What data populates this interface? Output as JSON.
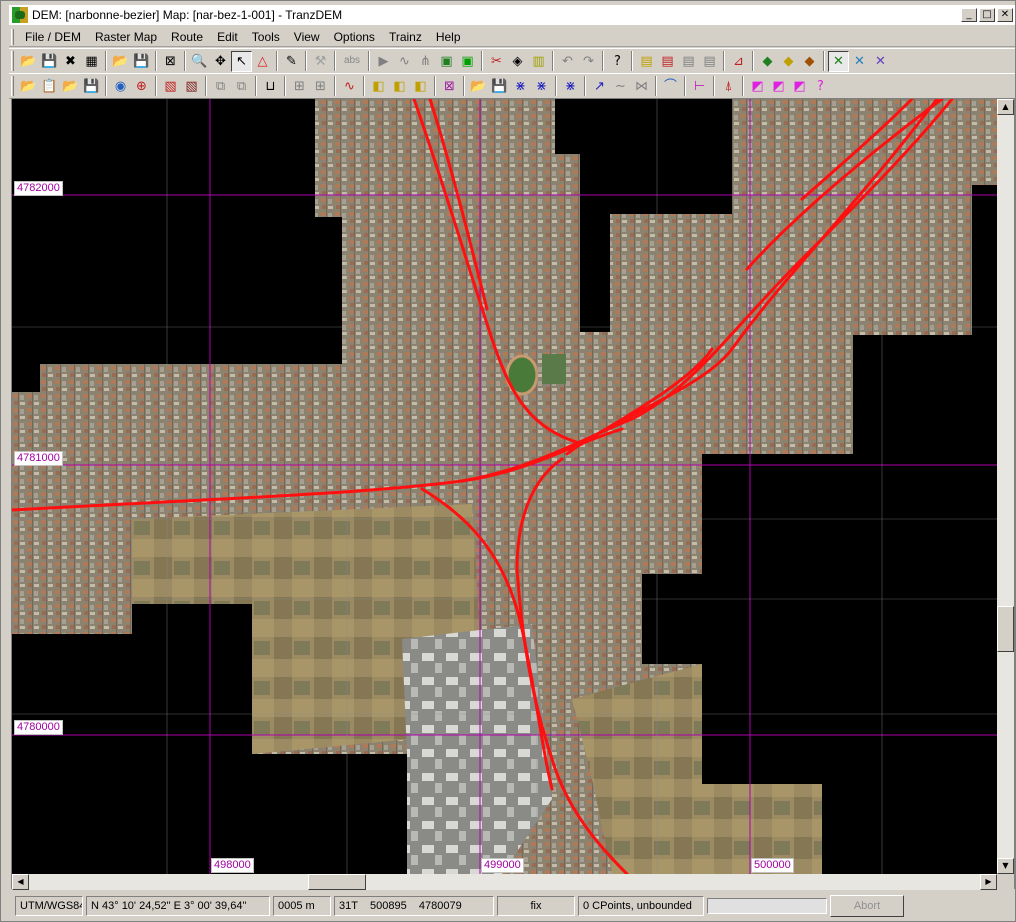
{
  "window": {
    "title": "DEM: [narbonne-bezier] Map: [nar-bez-1-001] - TranzDEM",
    "controls": {
      "minimize": "_",
      "maximize": "□",
      "close": "✕"
    }
  },
  "menu": [
    "File / DEM",
    "Raster Map",
    "Route",
    "Edit",
    "Tools",
    "View",
    "Options",
    "Trainz",
    "Help"
  ],
  "toolbar1": [
    {
      "icon": "open-folder-icon",
      "glyph": "📂"
    },
    {
      "icon": "save-icon",
      "glyph": "💾"
    },
    {
      "icon": "delete-map-icon",
      "glyph": "✖"
    },
    {
      "icon": "map-color-icon",
      "glyph": "▦"
    },
    {
      "sep": true
    },
    {
      "icon": "open-raster-icon",
      "glyph": "📂"
    },
    {
      "icon": "save-raster-icon",
      "glyph": "💾"
    },
    {
      "sep": true
    },
    {
      "icon": "zoom-cross-icon",
      "glyph": "⊠"
    },
    {
      "sep": true
    },
    {
      "icon": "magnifier-icon",
      "glyph": "🔍"
    },
    {
      "icon": "pan-icon",
      "glyph": "✥"
    },
    {
      "icon": "pointer-icon",
      "glyph": "↖",
      "pressed": true
    },
    {
      "icon": "triangle-icon",
      "glyph": "△",
      "color": "#e02020"
    },
    {
      "sep": true
    },
    {
      "icon": "eyedropper-icon",
      "glyph": "✎"
    },
    {
      "sep": true
    },
    {
      "icon": "tools-disabled-icon",
      "glyph": "⚒",
      "color": "#a0a0a0"
    },
    {
      "sep": true
    },
    {
      "icon": "abs-icon",
      "text": "abs"
    },
    {
      "sep": true
    },
    {
      "icon": "play-icon",
      "glyph": "▶",
      "color": "#808080"
    },
    {
      "icon": "curve-icon",
      "glyph": "∿",
      "color": "#808080"
    },
    {
      "icon": "track-split-icon",
      "glyph": "⋔",
      "color": "#808080"
    },
    {
      "icon": "track-select-icon",
      "glyph": "▣",
      "color": "#208020"
    },
    {
      "icon": "track-green-icon",
      "glyph": "▣",
      "color": "#00a000"
    },
    {
      "sep": true
    },
    {
      "icon": "scissors-icon",
      "glyph": "✂",
      "color": "#c02020"
    },
    {
      "icon": "fill-icon",
      "glyph": "◈"
    },
    {
      "icon": "ruler-icon",
      "glyph": "▥",
      "color": "#a0a000"
    },
    {
      "sep": true
    },
    {
      "icon": "undo-icon",
      "glyph": "↶",
      "color": "#808080"
    },
    {
      "icon": "redo-icon",
      "glyph": "↷",
      "color": "#808080"
    },
    {
      "sep": true
    },
    {
      "icon": "help-icon",
      "glyph": "?",
      "color": "#000000"
    },
    {
      "sep": true
    },
    {
      "icon": "layer-icon",
      "glyph": "▤",
      "color": "#c0a000"
    },
    {
      "icon": "layer-red-icon",
      "glyph": "▤",
      "color": "#c02020"
    },
    {
      "icon": "layer-grey-icon",
      "glyph": "▤",
      "color": "#808080"
    },
    {
      "icon": "layer-grey2-icon",
      "glyph": "▤",
      "color": "#808080"
    },
    {
      "sep": true
    },
    {
      "icon": "measure-icon",
      "glyph": "⊿",
      "color": "#c02020"
    },
    {
      "sep": true
    },
    {
      "icon": "texture-icon",
      "glyph": "◆",
      "color": "#208020"
    },
    {
      "icon": "texture2-icon",
      "glyph": "◆",
      "color": "#c0a000"
    },
    {
      "icon": "texture3-icon",
      "glyph": "◆",
      "color": "#a05000"
    },
    {
      "sep": true
    },
    {
      "icon": "cross-green-icon",
      "glyph": "✕",
      "color": "#208020",
      "pressed": true
    },
    {
      "icon": "cross-blue-icon",
      "glyph": "✕",
      "color": "#2080c0"
    },
    {
      "icon": "cross-multi-icon",
      "glyph": "✕",
      "color": "#6040c0"
    }
  ],
  "toolbar2": [
    {
      "icon": "open-icon",
      "glyph": "📂"
    },
    {
      "icon": "paste-icon",
      "glyph": "📋"
    },
    {
      "icon": "open2-icon",
      "glyph": "📂"
    },
    {
      "icon": "save-grey-icon",
      "glyph": "💾",
      "color": "#808080"
    },
    {
      "sep": true
    },
    {
      "icon": "globe-icon",
      "glyph": "◉",
      "color": "#2060c0"
    },
    {
      "icon": "globe-grid-icon",
      "glyph": "⊕",
      "color": "#c02020"
    },
    {
      "sep": true
    },
    {
      "icon": "frame-red-icon",
      "glyph": "▧",
      "color": "#c02020"
    },
    {
      "icon": "frames-icon",
      "glyph": "▧",
      "color": "#802020"
    },
    {
      "sep": true
    },
    {
      "icon": "copy-grey-icon",
      "glyph": "⧉",
      "color": "#808080"
    },
    {
      "icon": "copy-grey2-icon",
      "glyph": "⧉",
      "color": "#808080"
    },
    {
      "sep": true
    },
    {
      "icon": "bucket-icon",
      "glyph": "⊔"
    },
    {
      "sep": true
    },
    {
      "icon": "grid-select-icon",
      "glyph": "⊞",
      "color": "#808080"
    },
    {
      "icon": "grid-select2-icon",
      "glyph": "⊞",
      "color": "#808080"
    },
    {
      "sep": true
    },
    {
      "icon": "wave-icon",
      "glyph": "∿",
      "color": "#c02020"
    },
    {
      "sep": true
    },
    {
      "icon": "tiles-icon",
      "glyph": "◧",
      "color": "#c0a000"
    },
    {
      "icon": "tiles2-icon",
      "glyph": "◧",
      "color": "#c0a000"
    },
    {
      "icon": "tiles3-icon",
      "glyph": "◧",
      "color": "#c0a000"
    },
    {
      "sep": true
    },
    {
      "icon": "bbox-icon",
      "glyph": "⊠",
      "color": "#a020a0"
    },
    {
      "sep": true
    },
    {
      "icon": "open3-icon",
      "glyph": "📂"
    },
    {
      "icon": "save3-icon",
      "glyph": "💾"
    },
    {
      "icon": "junction-icon",
      "glyph": "⋇",
      "color": "#2020c0"
    },
    {
      "icon": "junction2-icon",
      "glyph": "⋇",
      "color": "#2020c0"
    },
    {
      "sep": true
    },
    {
      "icon": "junction3-icon",
      "glyph": "⋇",
      "color": "#2020c0"
    },
    {
      "sep": true
    },
    {
      "icon": "track-edit-icon",
      "glyph": "↗",
      "color": "#2020c0"
    },
    {
      "icon": "track-smooth-icon",
      "glyph": "∼",
      "color": "#808080"
    },
    {
      "icon": "track-cut-icon",
      "glyph": "⋈",
      "color": "#808080"
    },
    {
      "sep": true
    },
    {
      "icon": "profile-icon",
      "glyph": "⌒",
      "color": "#2060c0"
    },
    {
      "sep": true
    },
    {
      "icon": "span-icon",
      "glyph": "⊢",
      "color": "#c020c0"
    },
    {
      "sep": true
    },
    {
      "icon": "signal-icon",
      "glyph": "⍋",
      "color": "#c02020"
    },
    {
      "sep": true
    },
    {
      "icon": "object-pink-icon",
      "glyph": "◩",
      "color": "#e020e0"
    },
    {
      "icon": "object-pink2-icon",
      "glyph": "◩",
      "color": "#e020e0"
    },
    {
      "icon": "object-pink3-icon",
      "glyph": "◩",
      "color": "#e020e0"
    },
    {
      "icon": "object-help-icon",
      "glyph": "?",
      "color": "#e020e0"
    }
  ],
  "map": {
    "grid_labels": [
      {
        "text": "4782000",
        "name": "northing-4782000-label"
      },
      {
        "text": "4781000",
        "name": "northing-4781000-label"
      },
      {
        "text": "4780000",
        "name": "northing-4780000-label"
      },
      {
        "text": "498000",
        "name": "easting-498000-label"
      },
      {
        "text": "499000",
        "name": "easting-499000-label"
      },
      {
        "text": "500000",
        "name": "easting-500000-label"
      }
    ],
    "colors": {
      "grid": "#b000b0",
      "track": "#ff1010",
      "background": "#000000"
    }
  },
  "status": {
    "projection": "UTM/WGS84",
    "latlon": "N 43° 10' 24,52\"   E 3° 00' 39,64\"",
    "resolution": "0005 m",
    "utm": "31T    500895    4780079",
    "mode": "fix",
    "cpoints": "0 CPoints, unbounded",
    "abort": "Abort"
  }
}
